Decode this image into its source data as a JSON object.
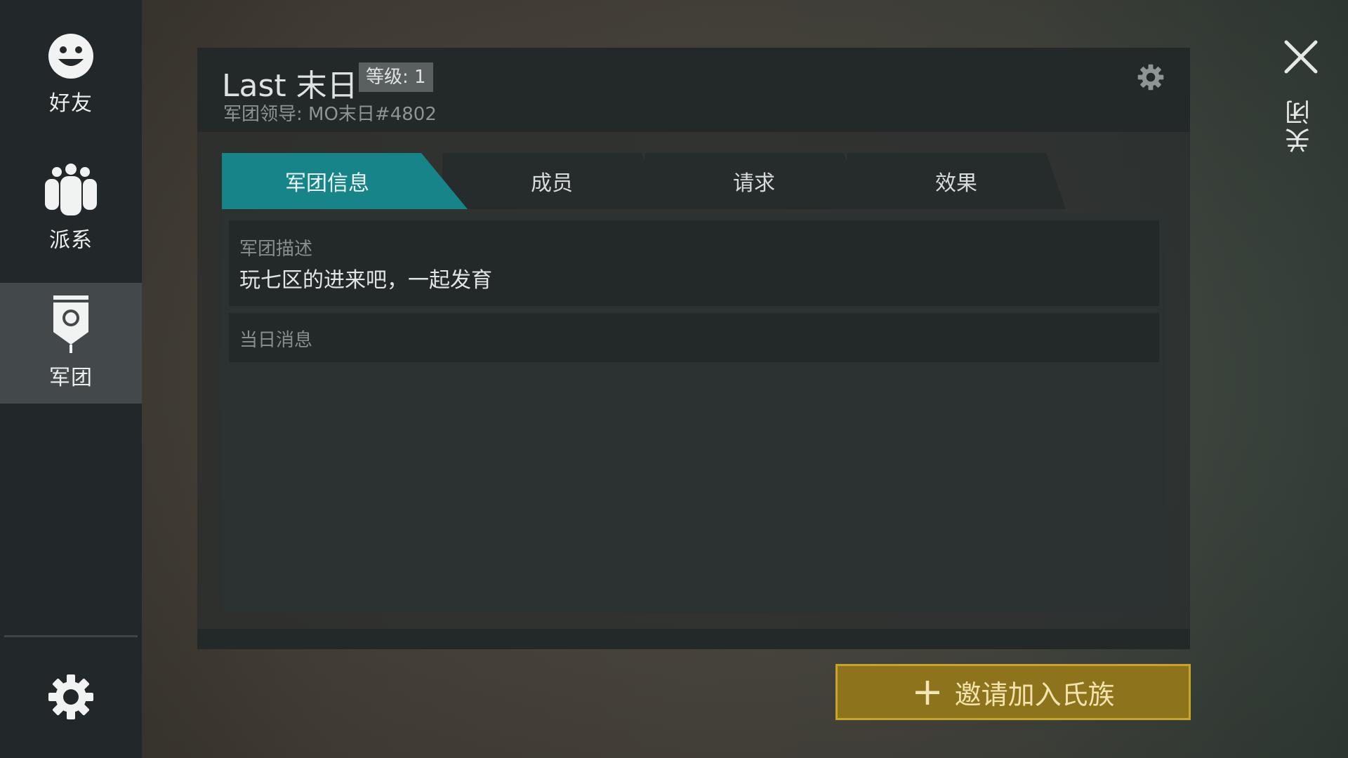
{
  "sidebar": {
    "items": [
      {
        "label": "好友",
        "icon": "smiley-face-icon"
      },
      {
        "label": "派系",
        "icon": "group-people-icon"
      },
      {
        "label": "军团",
        "icon": "clan-banner-icon"
      }
    ],
    "active_index": 2,
    "settings_icon": "gear-icon"
  },
  "panel": {
    "clan_name": "Last 末日",
    "level": "等级: 1",
    "leader": "军团领导: MO末日#4802",
    "tabs": [
      {
        "label": "军团信息",
        "active": true
      },
      {
        "label": "成员",
        "active": false
      },
      {
        "label": "请求",
        "active": false
      },
      {
        "label": "效果",
        "active": false
      }
    ],
    "description_label": "军团描述",
    "description_text": "玩七区的进来吧，一起发育",
    "message_label": "当日消息"
  },
  "invite_button": {
    "label": "邀请加入氏族"
  },
  "close": {
    "label": "关闭"
  },
  "colors": {
    "sidebar_bg": "#222729",
    "sidebar_active": "#43494b",
    "tab_active": "#178489",
    "invite_bg": "#8c731c",
    "invite_border": "#c9a42a"
  }
}
